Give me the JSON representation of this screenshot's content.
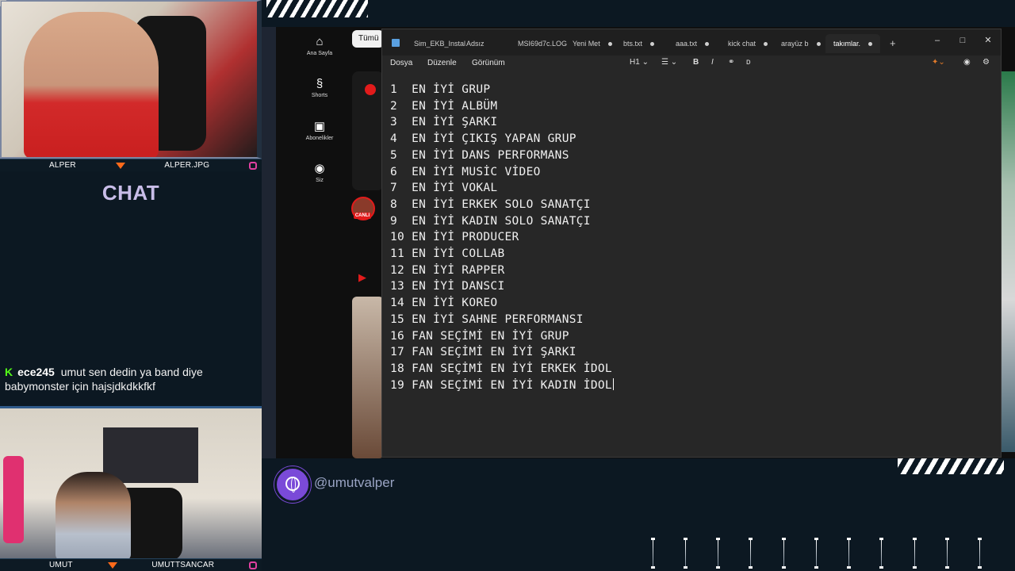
{
  "overlay": {
    "top_cam_left_name": "ALPER",
    "top_cam_right_name": "ALPER.JPG",
    "chat_title": "CHAT",
    "chat_message": {
      "username": "ece245",
      "text": "umut sen dedin ya band diye babymonster için hajsjdkdkkfkf"
    },
    "bottom_cam_left_name": "UMUT",
    "bottom_cam_right_name": "UMUTTSANCAR",
    "social_handle": "@umutvalper"
  },
  "youtube": {
    "chip": "Tümü",
    "sidebar": [
      {
        "label": "Ana Sayfa",
        "icon": "home-icon",
        "glyph": "⌂"
      },
      {
        "label": "Shorts",
        "icon": "shorts-icon",
        "glyph": "§"
      },
      {
        "label": "Abonelikler",
        "icon": "subscriptions-icon",
        "glyph": "▣"
      },
      {
        "label": "Siz",
        "icon": "account-icon",
        "glyph": "◉"
      }
    ],
    "live_badge": "CANLI",
    "accent_color": "#e21b1b"
  },
  "notepad": {
    "tabs": [
      {
        "label": "Sim_EKB_Instal",
        "modified": false
      },
      {
        "label": "Adsız",
        "modified": false
      },
      {
        "label": "MSI69d7c.LOG",
        "modified": false
      },
      {
        "label": "Yeni Met",
        "modified": true
      },
      {
        "label": "bts.txt",
        "modified": true
      },
      {
        "label": "aaa.txt",
        "modified": true
      },
      {
        "label": "kick chat",
        "modified": true
      },
      {
        "label": "arayüz b",
        "modified": true
      },
      {
        "label": "takımlar.",
        "modified": true,
        "active": true
      }
    ],
    "new_tab": "+",
    "menu": {
      "file": "Dosya",
      "edit": "Düzenle",
      "view": "Görünüm"
    },
    "toolbar": {
      "heading": "H1",
      "bold": "B",
      "italic": "I"
    },
    "lines": [
      "1  EN İYİ GRUP",
      "2  EN İYİ ALBÜM",
      "3  EN İYİ ŞARKI",
      "4  EN İYİ ÇIKIŞ YAPAN GRUP",
      "5  EN İYİ DANS PERFORMANS",
      "6  EN İYİ MUSİC VİDEO",
      "7  EN İYİ VOKAL",
      "8  EN İYİ ERKEK SOLO SANATÇI",
      "9  EN İYİ KADIN SOLO SANATÇI",
      "10 EN İYİ PRODUCER",
      "11 EN İYİ COLLAB",
      "12 EN İYİ RAPPER",
      "13 EN İYİ DANSCI",
      "14 EN İYİ KOREO",
      "15 EN İYİ SAHNE PERFORMANSI",
      "16 FAN SEÇİMİ EN İYİ GRUP",
      "17 FAN SEÇİMİ EN İYİ ŞARKI",
      "18 FAN SEÇİMİ EN İYİ ERKEK İDOL",
      "19 FAN SEÇİMİ EN İYİ KADIN İDOL"
    ]
  }
}
